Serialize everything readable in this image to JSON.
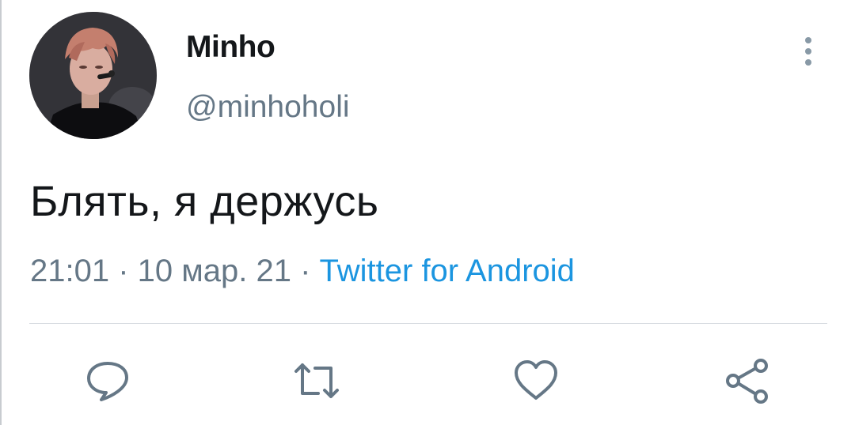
{
  "tweet": {
    "author": {
      "display_name": "Minho",
      "handle": "@minhoholi",
      "avatar_icon": "profile-photo"
    },
    "text": "Блять, я держусь",
    "meta": {
      "time": "21:01",
      "separator": " · ",
      "date": "10 мар. 21",
      "source": "Twitter for Android"
    },
    "actions": [
      {
        "icon": "reply-icon"
      },
      {
        "icon": "retweet-icon"
      },
      {
        "icon": "like-icon"
      },
      {
        "icon": "share-icon"
      }
    ],
    "more_icon": "more-vertical-icon"
  },
  "colors": {
    "primary_text": "#14171a",
    "secondary_text": "#657786",
    "link": "#1b95e0",
    "icon": "#657786"
  }
}
